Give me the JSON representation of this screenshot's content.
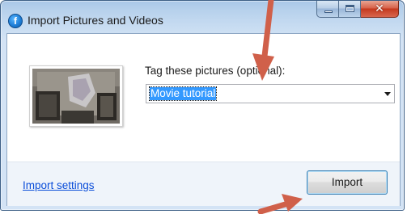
{
  "window": {
    "title": "Import Pictures and Videos",
    "app_icon": "f-app-icon",
    "caption_buttons": {
      "minimize_icon": "minimize-icon",
      "maximize_icon": "maximize-icon",
      "close_icon": "close-icon",
      "close_glyph": "✕"
    }
  },
  "content": {
    "tag_label": "Tag these pictures (optional):",
    "tag_value": "Movie tutorial"
  },
  "footer": {
    "import_settings_link": "Import settings",
    "import_button": "Import"
  },
  "annotations": {
    "arrow_color": "#d0604a"
  },
  "colors": {
    "link": "#0a4dd9",
    "selection": "#3399ff",
    "title_bar": "#b7d1ec",
    "close_button": "#c4391e"
  }
}
